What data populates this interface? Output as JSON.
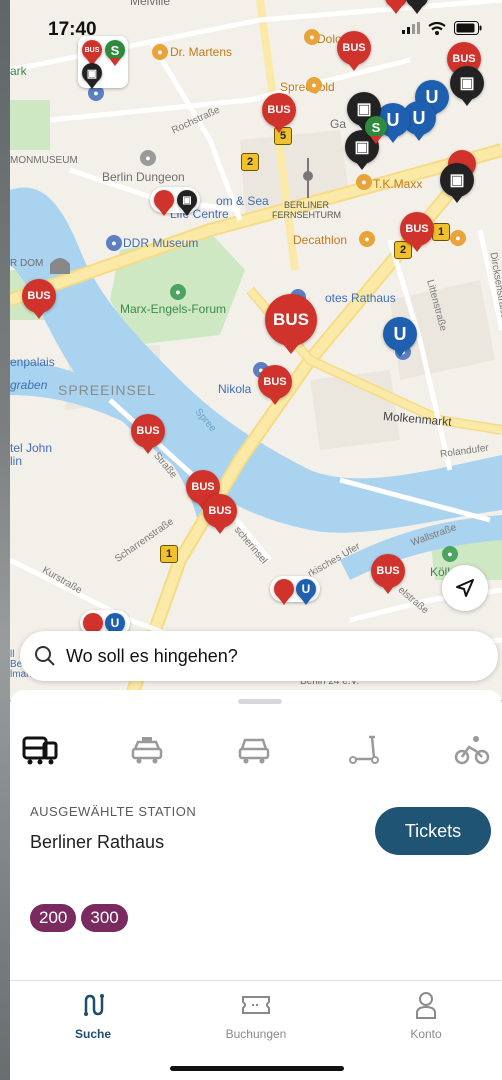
{
  "status_bar": {
    "time": "17:40"
  },
  "map": {
    "labels": {
      "dr_martens": "Dr. Martens",
      "melville": "Melville",
      "rochstrasse": "Rochstraße",
      "spreegold": "Spreegold",
      "dolo": "Dolo",
      "museum": "MONMUSEUM",
      "berlin_dungeon": "Berlin Dungeon",
      "sea_life": "om & Sea",
      "sea_life2": "Life Centre",
      "ga": "Ga",
      "tk_maxx": "T.K.Maxx",
      "fernsehturm": "BERLINER\nFERNSEHTURM",
      "ddr_museum": "DDR Museum",
      "decathlon": "Decathlon",
      "r_dom": "R DOM",
      "marx_engels": "Marx-Engels-Forum",
      "rotes_rathaus": "otes Rathaus",
      "littenstrasse": "Littenstraße",
      "dircksenstrasse": "Dircksenstraße",
      "stgarten": "stga",
      "enpalais": "enpalais",
      "graben": "graben",
      "spreeinsel": "SPREEINSEL",
      "nikolai": "Nikola",
      "molkenmarkt": "Molkenmarkt",
      "rolandufer": "Rolandufer",
      "tel_john": "tel John",
      "lin": "lin",
      "spree": "Spree",
      "strasse": "Straße",
      "scharrenstrasse": "Scharrenstraße",
      "kurstrasse": "Kurstraße",
      "fischerinsel": "scherinsel",
      "markisches_ufer": "rkisches Ufer",
      "wallstrasse": "Wallstraße",
      "kollnischer": "Köllnisc",
      "park": "rk",
      "elstrasse": "elstraße",
      "berlin24": "Berlin 24 e.V.",
      "ark": "ark",
      "ube": "ll\nBe\nlmark"
    },
    "pins": {
      "bus": "BUS"
    },
    "shields": [
      "2",
      "5",
      "2",
      "1",
      "1"
    ],
    "ubahn_letter": "U",
    "sbahn_letter": "S"
  },
  "search": {
    "placeholder": "Wo soll es hingehen?"
  },
  "sheet": {
    "selected_label": "AUSGEWÄHLTE STATION",
    "station_name": "Berliner Rathaus",
    "tickets_button": "Tickets",
    "lines": [
      "200",
      "300"
    ]
  },
  "tabs": [
    {
      "label": "Suche",
      "icon": "route-icon",
      "active": true
    },
    {
      "label": "Buchungen",
      "icon": "ticket-icon",
      "active": false
    },
    {
      "label": "Konto",
      "icon": "person-icon",
      "active": false
    }
  ],
  "colors": {
    "bus_red": "#d0332b",
    "ubahn_blue": "#1f5fb0",
    "tickets_button": "#205474",
    "line_badge": "#7b2a60",
    "active_tab": "#1f4d6b"
  }
}
